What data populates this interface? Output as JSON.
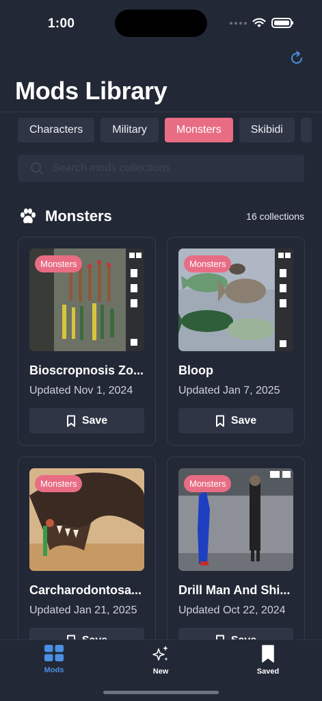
{
  "status": {
    "time": "1:00"
  },
  "header": {
    "title": "Mods Library"
  },
  "tabs": [
    {
      "label": "Characters",
      "active": false
    },
    {
      "label": "Military",
      "active": false
    },
    {
      "label": "Monsters",
      "active": true
    },
    {
      "label": "Skibidi",
      "active": false
    }
  ],
  "search": {
    "placeholder": "Search mods collections",
    "value": ""
  },
  "section": {
    "icon": "paw-icon",
    "title": "Monsters",
    "count": "16 collections"
  },
  "cards": [
    {
      "badge": "Monsters",
      "title": "Bioscropnosis Zo...",
      "date": "Updated Nov 1, 2024",
      "save_label": "Save"
    },
    {
      "badge": "Monsters",
      "title": "Bloop",
      "date": "Updated Jan 7, 2025",
      "save_label": "Save"
    },
    {
      "badge": "Monsters",
      "title": "Carcharodontosa...",
      "date": "Updated Jan 21, 2025",
      "save_label": "Save"
    },
    {
      "badge": "Monsters",
      "title": "Drill Man And Shi...",
      "date": "Updated Oct 22, 2024",
      "save_label": "Save"
    }
  ],
  "tabbar": [
    {
      "label": "Mods",
      "icon": "grid-icon",
      "active": true
    },
    {
      "label": "New",
      "icon": "sparkles-icon",
      "active": false
    },
    {
      "label": "Saved",
      "icon": "bookmark-icon",
      "active": false
    }
  ],
  "colors": {
    "accent": "#e86d84",
    "active_tab": "#4a90e2",
    "background": "#232836"
  }
}
